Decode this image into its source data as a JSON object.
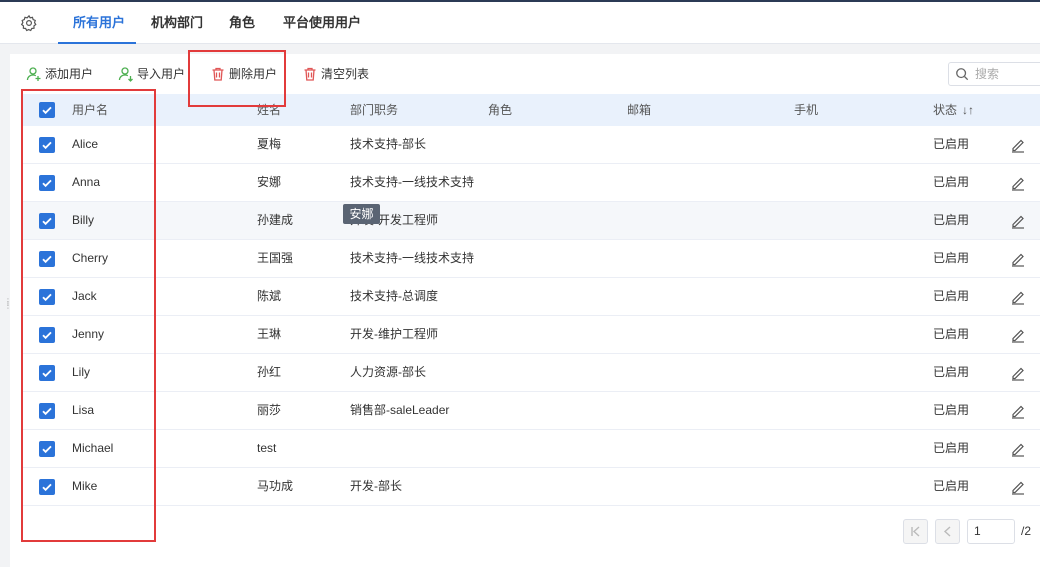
{
  "tabs": [
    {
      "label": "所有用户"
    },
    {
      "label": "机构部门"
    },
    {
      "label": "角色"
    },
    {
      "label": "平台使用用户"
    }
  ],
  "toolbar": {
    "add_label": "添加用户",
    "import_label": "导入用户",
    "delete_label": "删除用户",
    "clear_label": "清空列表",
    "search_placeholder": "搜索"
  },
  "colors": {
    "accent": "#2b73d9",
    "highlight": "#e23b3b",
    "add_icon": "#4caf50",
    "delete_icon": "#e05656"
  },
  "table": {
    "headers": {
      "username": "用户名",
      "name": "姓名",
      "dept": "部门职务",
      "role": "角色",
      "email": "邮箱",
      "phone": "手机",
      "status": "状态",
      "sort_icon": "↓↑"
    },
    "rows": [
      {
        "username": "Alice",
        "name": "夏梅",
        "dept": "技术支持-部长",
        "role": "",
        "email": "",
        "phone": "",
        "status": "已启用",
        "checked": true
      },
      {
        "username": "Anna",
        "name": "安娜",
        "dept": "技术支持-一线技术支持",
        "role": "",
        "email": "",
        "phone": "",
        "status": "已启用",
        "checked": true
      },
      {
        "username": "Billy",
        "name": "孙建成",
        "dept": "开发-开发工程师",
        "role": "",
        "email": "",
        "phone": "",
        "status": "已启用",
        "checked": true
      },
      {
        "username": "Cherry",
        "name": "王国强",
        "dept": "技术支持-一线技术支持",
        "role": "",
        "email": "",
        "phone": "",
        "status": "已启用",
        "checked": true
      },
      {
        "username": "Jack",
        "name": "陈斌",
        "dept": "技术支持-总调度",
        "role": "",
        "email": "",
        "phone": "",
        "status": "已启用",
        "checked": true
      },
      {
        "username": "Jenny",
        "name": "王琳",
        "dept": "开发-维护工程师",
        "role": "",
        "email": "",
        "phone": "",
        "status": "已启用",
        "checked": true
      },
      {
        "username": "Lily",
        "name": "孙红",
        "dept": "人力资源-部长",
        "role": "",
        "email": "",
        "phone": "",
        "status": "已启用",
        "checked": true
      },
      {
        "username": "Lisa",
        "name": "丽莎",
        "dept": "销售部-saleLeader",
        "role": "",
        "email": "",
        "phone": "",
        "status": "已启用",
        "checked": true
      },
      {
        "username": "Michael",
        "name": "test",
        "dept": "",
        "role": "",
        "email": "",
        "phone": "",
        "status": "已启用",
        "checked": true
      },
      {
        "username": "Mike",
        "name": "马功成",
        "dept": "开发-部长",
        "role": "",
        "email": "",
        "phone": "",
        "status": "已启用",
        "checked": true
      }
    ]
  },
  "tooltip": {
    "text": "安娜"
  },
  "pager": {
    "current_page": "1",
    "total_pages": "/2"
  }
}
